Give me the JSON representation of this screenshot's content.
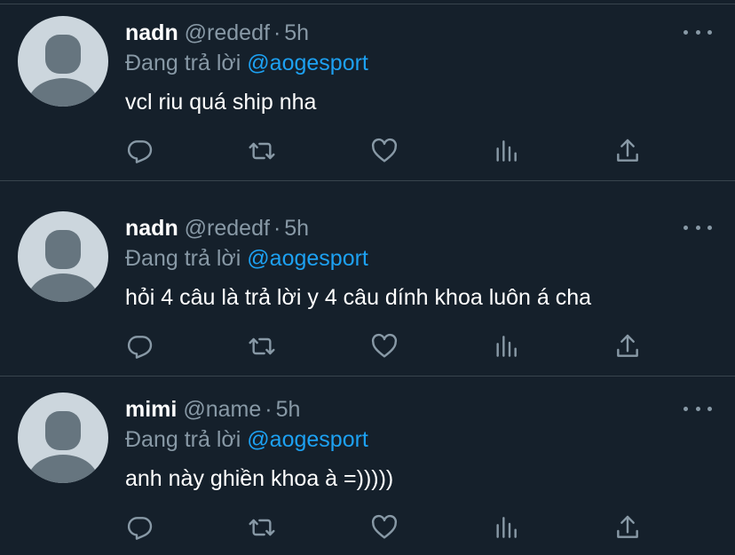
{
  "tweets": [
    {
      "name": "nadn",
      "handle": "@rededf",
      "separator": "·",
      "time": "5h",
      "reply_prefix": "Đang trả lời",
      "reply_to": "@aogesport",
      "text": "hỏi 4 câu là trả lời y 4 câu dính khoa luôn á cha"
    },
    {
      "name": "mimi",
      "handle": "@name",
      "separator": "·",
      "time": "5h",
      "reply_prefix": "Đang trả lời",
      "reply_to": "@aogesport",
      "text": "anh này ghiền khoa à =)))))"
    },
    {
      "name": "nadn",
      "handle": "@rededf",
      "separator": "·",
      "time": "5h",
      "reply_prefix": "Đang trả lời",
      "reply_to": "@aogesport",
      "text": "vcl riu quá ship nha"
    }
  ],
  "icons": {
    "reply": "reply-icon",
    "retweet": "retweet-icon",
    "like": "heart-icon",
    "stats": "analytics-icon",
    "share": "share-icon",
    "more": "more-icon"
  },
  "colors": {
    "background": "#15202b",
    "divider": "#38444d",
    "secondary_text": "#8899a6",
    "link": "#1da1f2",
    "primary_text": "#ffffff"
  }
}
